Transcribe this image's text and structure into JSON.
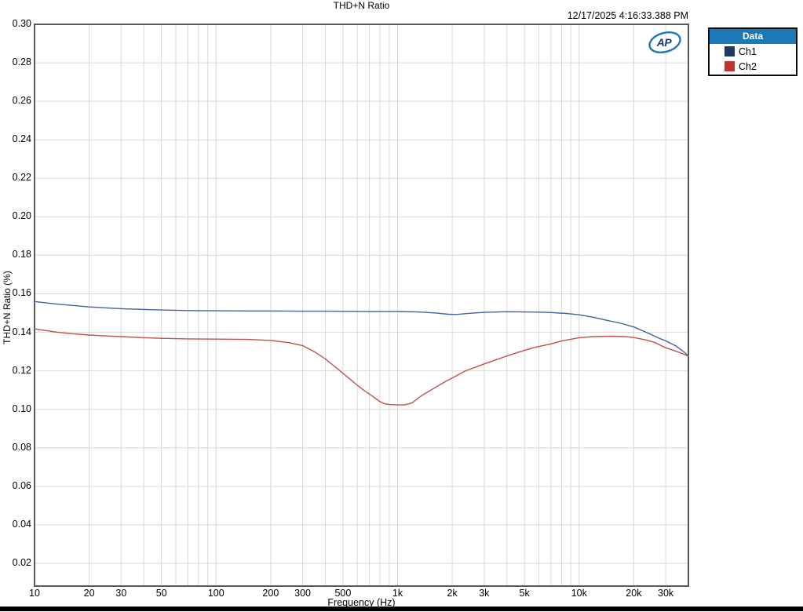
{
  "header": {
    "title": "THD+N Ratio",
    "timestamp": "12/17/2025 4:16:33.388 PM"
  },
  "logo": {
    "text": "AP",
    "ellipse_color": "#1878bc",
    "text_color": "#1e3a6e"
  },
  "legend": {
    "title": "Data",
    "header_bg": "#1b79b7",
    "header_text_color": "#ffffff",
    "items": [
      {
        "label": "Ch1",
        "color": "#1f3864"
      },
      {
        "label": "Ch2",
        "color": "#c5302d"
      }
    ]
  },
  "chart_data": {
    "type": "line",
    "title": "THD+N Ratio",
    "xlabel": "Frequency (Hz)",
    "ylabel": "THD+N Ratio (%)",
    "x_scale": "log",
    "xlim": [
      10,
      40000
    ],
    "ylim": [
      0.00818,
      0.3
    ],
    "grid": true,
    "grid_color": "#d9d9d9",
    "border_color": "#595959",
    "legend_position": "top-right-outside",
    "y_ticks": [
      0.02,
      0.04,
      0.06,
      0.08,
      0.1,
      0.12,
      0.14,
      0.16,
      0.18,
      0.2,
      0.22,
      0.24,
      0.26,
      0.28,
      0.3
    ],
    "x_ticks": [
      {
        "v": 10,
        "label": "10"
      },
      {
        "v": 20,
        "label": "20"
      },
      {
        "v": 30,
        "label": "30"
      },
      {
        "v": 50,
        "label": "50"
      },
      {
        "v": 100,
        "label": "100"
      },
      {
        "v": 200,
        "label": "200"
      },
      {
        "v": 300,
        "label": "300"
      },
      {
        "v": 500,
        "label": "500"
      },
      {
        "v": 1000,
        "label": "1k"
      },
      {
        "v": 2000,
        "label": "2k"
      },
      {
        "v": 3000,
        "label": "3k"
      },
      {
        "v": 5000,
        "label": "5k"
      },
      {
        "v": 10000,
        "label": "10k"
      },
      {
        "v": 20000,
        "label": "20k"
      },
      {
        "v": 30000,
        "label": "30k"
      }
    ],
    "series": [
      {
        "name": "Ch1",
        "color": "#41639c",
        "points": [
          [
            10,
            0.156
          ],
          [
            13,
            0.1548
          ],
          [
            16,
            0.154
          ],
          [
            20,
            0.1532
          ],
          [
            25,
            0.1527
          ],
          [
            30,
            0.1523
          ],
          [
            40,
            0.1519
          ],
          [
            50,
            0.1516
          ],
          [
            70,
            0.1513
          ],
          [
            100,
            0.1512
          ],
          [
            150,
            0.1511
          ],
          [
            200,
            0.1511
          ],
          [
            300,
            0.151
          ],
          [
            400,
            0.151
          ],
          [
            500,
            0.1509
          ],
          [
            700,
            0.1508
          ],
          [
            1000,
            0.1508
          ],
          [
            1300,
            0.1506
          ],
          [
            1600,
            0.1501
          ],
          [
            1900,
            0.1494
          ],
          [
            2100,
            0.1493
          ],
          [
            2500,
            0.1499
          ],
          [
            3000,
            0.1504
          ],
          [
            4000,
            0.1507
          ],
          [
            5000,
            0.1506
          ],
          [
            6000,
            0.1505
          ],
          [
            7000,
            0.1503
          ],
          [
            8500,
            0.1498
          ],
          [
            10000,
            0.1491
          ],
          [
            12000,
            0.1478
          ],
          [
            14000,
            0.1464
          ],
          [
            17000,
            0.1447
          ],
          [
            20000,
            0.1428
          ],
          [
            24000,
            0.1396
          ],
          [
            28000,
            0.1367
          ],
          [
            30000,
            0.1356
          ],
          [
            34000,
            0.133
          ],
          [
            37000,
            0.1305
          ],
          [
            40000,
            0.1278
          ]
        ]
      },
      {
        "name": "Ch2",
        "color": "#c0504d",
        "points": [
          [
            10,
            0.1418
          ],
          [
            13,
            0.1402
          ],
          [
            16,
            0.1393
          ],
          [
            20,
            0.1386
          ],
          [
            25,
            0.1381
          ],
          [
            30,
            0.1378
          ],
          [
            40,
            0.1372
          ],
          [
            50,
            0.1369
          ],
          [
            70,
            0.1366
          ],
          [
            100,
            0.1365
          ],
          [
            150,
            0.1363
          ],
          [
            200,
            0.1358
          ],
          [
            250,
            0.1347
          ],
          [
            300,
            0.1331
          ],
          [
            350,
            0.1298
          ],
          [
            400,
            0.1262
          ],
          [
            450,
            0.1223
          ],
          [
            500,
            0.1187
          ],
          [
            550,
            0.1155
          ],
          [
            600,
            0.1125
          ],
          [
            650,
            0.11
          ],
          [
            700,
            0.1079
          ],
          [
            750,
            0.1059
          ],
          [
            800,
            0.104
          ],
          [
            850,
            0.1028
          ],
          [
            900,
            0.1025
          ],
          [
            1000,
            0.1023
          ],
          [
            1100,
            0.1023
          ],
          [
            1200,
            0.1033
          ],
          [
            1350,
            0.107
          ],
          [
            1590,
            0.111
          ],
          [
            1880,
            0.115
          ],
          [
            2000,
            0.1163
          ],
          [
            2370,
            0.12
          ],
          [
            3000,
            0.1236
          ],
          [
            3800,
            0.127
          ],
          [
            4600,
            0.1296
          ],
          [
            5600,
            0.132
          ],
          [
            7000,
            0.134
          ],
          [
            8000,
            0.1355
          ],
          [
            10000,
            0.1372
          ],
          [
            12000,
            0.1378
          ],
          [
            15000,
            0.138
          ],
          [
            18000,
            0.1378
          ],
          [
            20000,
            0.1373
          ],
          [
            23000,
            0.1362
          ],
          [
            26000,
            0.1348
          ],
          [
            30000,
            0.132
          ],
          [
            34000,
            0.1303
          ],
          [
            37000,
            0.129
          ],
          [
            40000,
            0.1276
          ]
        ]
      }
    ]
  }
}
